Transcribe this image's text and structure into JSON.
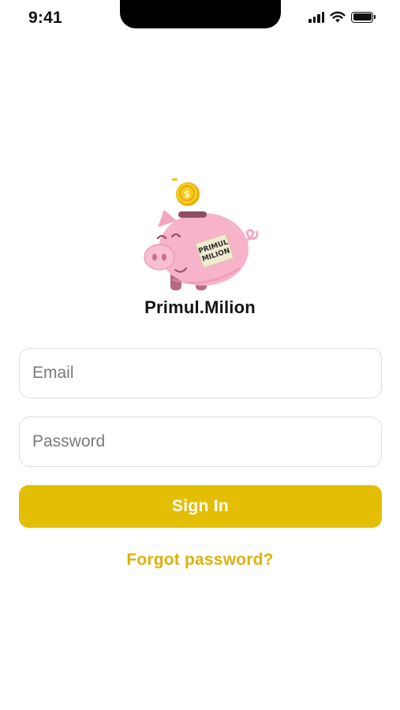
{
  "status_bar": {
    "time": "9:41",
    "icons": [
      "signal-icon",
      "wifi-icon",
      "battery-icon"
    ]
  },
  "brand": {
    "name": "Primul.Milion",
    "logo_sticker_text": "PRIMUL MILION",
    "logo": "piggy-bank-icon"
  },
  "login_form": {
    "email_placeholder": "Email",
    "password_placeholder": "Password",
    "sign_in_label": "Sign In",
    "forgot_password_label": "Forgot password?"
  },
  "colors": {
    "accent": "#e4be05",
    "link": "#dfb10a",
    "piggy_pink": "#f6b3c9",
    "coin_gold": "#f2c20e"
  }
}
